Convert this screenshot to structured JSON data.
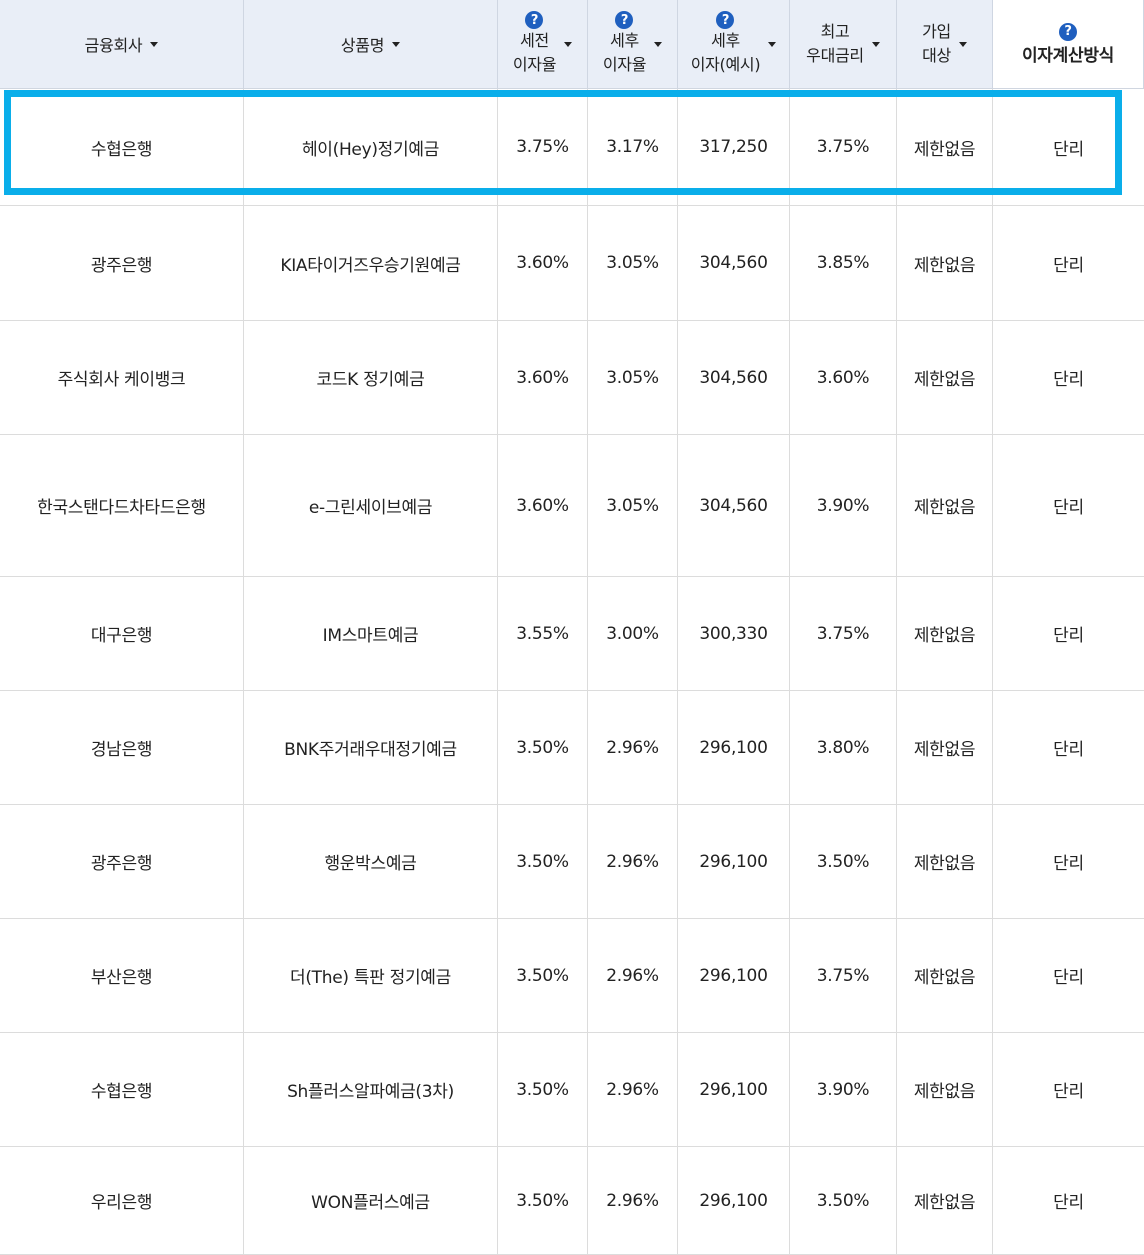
{
  "header": {
    "company": "금융회사",
    "product": "상품명",
    "pretax_line1": "세전",
    "pretax_line2": "이자율",
    "posttax_line1": "세후",
    "posttax_line2": "이자율",
    "interest_line1": "세후",
    "interest_line2": "이자(예시)",
    "max_line1": "최고",
    "max_line2": "우대금리",
    "join_line1": "가입",
    "join_line2": "대상",
    "calc": "이자계산방식",
    "help_glyph": "?"
  },
  "rows": [
    {
      "company": "수협은행",
      "product": "헤이(Hey)정기예금",
      "pretax": "3.75%",
      "posttax": "3.17%",
      "interest": "317,250",
      "max": "3.75%",
      "join": "제한없음",
      "calc": "단리"
    },
    {
      "company": "광주은행",
      "product": "KIA타이거즈우승기원예금",
      "pretax": "3.60%",
      "posttax": "3.05%",
      "interest": "304,560",
      "max": "3.85%",
      "join": "제한없음",
      "calc": "단리"
    },
    {
      "company": "주식회사 케이뱅크",
      "product": "코드K 정기예금",
      "pretax": "3.60%",
      "posttax": "3.05%",
      "interest": "304,560",
      "max": "3.60%",
      "join": "제한없음",
      "calc": "단리"
    },
    {
      "company": "한국스탠다드차타드은행",
      "product": "e-그린세이브예금",
      "pretax": "3.60%",
      "posttax": "3.05%",
      "interest": "304,560",
      "max": "3.90%",
      "join": "제한없음",
      "calc": "단리"
    },
    {
      "company": "대구은행",
      "product": "IM스마트예금",
      "pretax": "3.55%",
      "posttax": "3.00%",
      "interest": "300,330",
      "max": "3.75%",
      "join": "제한없음",
      "calc": "단리"
    },
    {
      "company": "경남은행",
      "product": "BNK주거래우대정기예금",
      "pretax": "3.50%",
      "posttax": "2.96%",
      "interest": "296,100",
      "max": "3.80%",
      "join": "제한없음",
      "calc": "단리"
    },
    {
      "company": "광주은행",
      "product": "행운박스예금",
      "pretax": "3.50%",
      "posttax": "2.96%",
      "interest": "296,100",
      "max": "3.50%",
      "join": "제한없음",
      "calc": "단리"
    },
    {
      "company": "부산은행",
      "product": "더(The) 특판 정기예금",
      "pretax": "3.50%",
      "posttax": "2.96%",
      "interest": "296,100",
      "max": "3.75%",
      "join": "제한없음",
      "calc": "단리"
    },
    {
      "company": "수협은행",
      "product": "Sh플러스알파예금(3차)",
      "pretax": "3.50%",
      "posttax": "2.96%",
      "interest": "296,100",
      "max": "3.90%",
      "join": "제한없음",
      "calc": "단리"
    },
    {
      "company": "우리은행",
      "product": "WON플러스예금",
      "pretax": "3.50%",
      "posttax": "2.96%",
      "interest": "296,100",
      "max": "3.50%",
      "join": "제한없음",
      "calc": "단리"
    }
  ],
  "colors": {
    "highlight": "#0aaeea",
    "header_bg": "#e9eef7",
    "help_icon": "#1f5fbf"
  }
}
